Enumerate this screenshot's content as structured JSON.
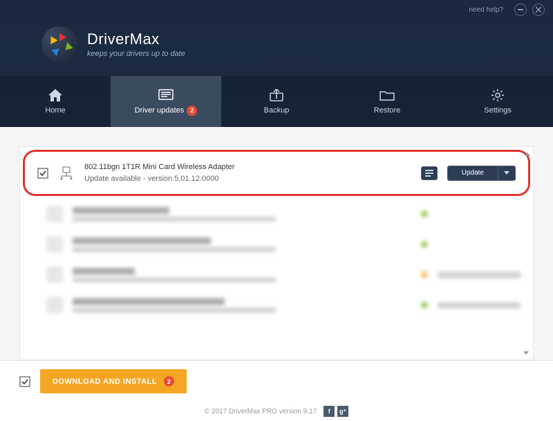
{
  "titlebar": {
    "help_link": "need help?"
  },
  "brand": {
    "name": "DriverMax",
    "tagline": "keeps your drivers up to date"
  },
  "nav": {
    "home": "Home",
    "updates": "Driver updates",
    "updates_badge": "2",
    "backup": "Backup",
    "restore": "Restore",
    "settings": "Settings"
  },
  "device": {
    "name": "802.11bgn 1T1R Mini Card Wireless Adapter",
    "status": "Update available - version 5.01.12.0000",
    "update_label": "Update"
  },
  "blurred": [
    {
      "w1": 140,
      "dot": "#7ab51d"
    },
    {
      "w1": 200,
      "dot": "#7ab51d"
    },
    {
      "w1": 90,
      "dot": "#f5a623",
      "right": true
    },
    {
      "w1": 220,
      "dot": "#7ab51d",
      "right": true
    }
  ],
  "bottom": {
    "download_label": "DOWNLOAD AND INSTALL",
    "download_badge": "2"
  },
  "footer": {
    "copyright": "© 2017 DriverMax PRO version 9.17"
  }
}
